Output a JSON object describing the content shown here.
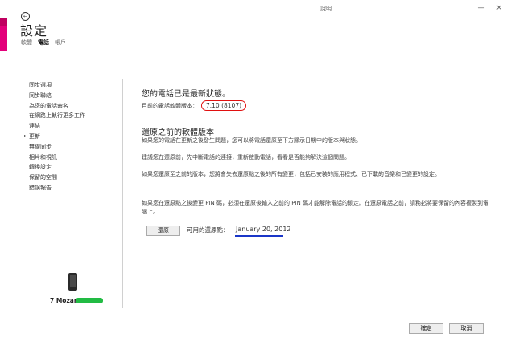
{
  "window": {
    "help_label": "說明",
    "minimize": "—",
    "close": "×"
  },
  "header": {
    "back_icon": "back-arrow-icon",
    "title": "設定",
    "tabs": [
      {
        "label": "軟體",
        "active": false
      },
      {
        "label": "電話",
        "active": true
      },
      {
        "label": "帳戶",
        "active": false
      }
    ]
  },
  "sidebar": {
    "items": [
      {
        "label": "同步選項",
        "active": false
      },
      {
        "label": "同步聯絡",
        "active": false
      },
      {
        "label": "為您的電話命名",
        "active": false
      },
      {
        "label": "在網路上執行更多工作",
        "active": false
      },
      {
        "label": "連結",
        "active": false
      },
      {
        "label": "更新",
        "active": true
      },
      {
        "label": "無線同步",
        "active": false
      },
      {
        "label": "相片和視訊",
        "active": false
      },
      {
        "label": "轉換設定",
        "active": false
      },
      {
        "label": "保留的空間",
        "active": false
      },
      {
        "label": "錯誤報告",
        "active": false
      }
    ],
    "phone_name": "7 Mozart"
  },
  "main": {
    "status_title": "您的電話已是最新狀態。",
    "version_label": "目前的電話軟體版本：",
    "version_value": "7.10 (8107)",
    "restore_heading": "還原之前的軟體版本",
    "para1": "如果您的電話在更新之後發生問題，您可以將電話還原至下方顯示日期中的版本與狀態。",
    "para2": "建議您在還原前，先中斷電話的連接，重新啟動電話，看看是否能夠解決這個問題。",
    "para3": "如果您還原至之前的版本，您將會失去還原點之後的所有變更，包括已安裝的應用程式、已下載的音樂和已變更的設定。",
    "para4": "如果您在還原點之後變更 PIN 碼，必須在還原後輸入之前的 PIN 碼才能解除電話的鎖定。在還原電話之前，請務必將要保留的內容複製到電腦上。",
    "restore_button": "還原",
    "restore_point_label": "可用的還原點：",
    "restore_point_value": "January 20, 2012"
  },
  "footer": {
    "ok": "確定",
    "cancel": "取消"
  },
  "colors": {
    "accent": "#e3007a",
    "highlight_circle": "#e01010",
    "underline": "#1a36c8",
    "redaction": "#22bb44"
  }
}
